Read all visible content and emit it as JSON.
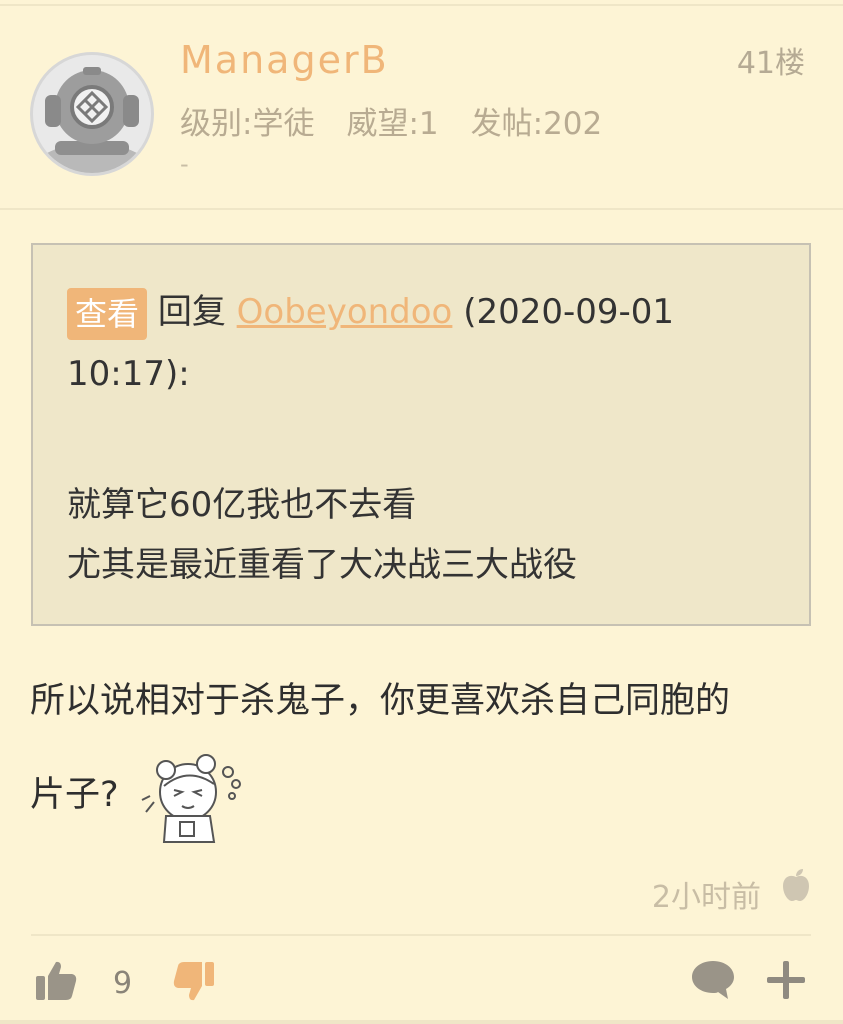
{
  "user": {
    "name": "ManagerB",
    "level": "级别:学徒",
    "prestige": "威望:1",
    "posts": "发帖:202",
    "signature": "-",
    "floor": "41楼"
  },
  "quote": {
    "view_badge": "查看",
    "reply_prefix": "回复",
    "reply_user": "Oobeyondoo",
    "reply_time": "(2020-09-01 10:17):",
    "lines": [
      "就算它60亿我也不去看",
      "尤其是最近重看了大决战三大战役"
    ]
  },
  "post": {
    "text_line1": "所以说相对于杀鬼子，你更喜欢杀自己同胞的",
    "text_line2": "片子?"
  },
  "footer": {
    "time": "2小时前",
    "like_count": "9"
  },
  "icons": {
    "avatar": "diving-helmet-avatar",
    "emoticon": "anime-girl-sweat-emoticon",
    "client": "apple-icon",
    "like": "thumbs-up-icon",
    "dislike": "thumbs-down-icon",
    "comment": "comment-bubble-icon",
    "more": "plus-icon"
  },
  "colors": {
    "background": "#fdf4d5",
    "accent": "#f0b679",
    "quote_bg": "#efe7c9"
  }
}
